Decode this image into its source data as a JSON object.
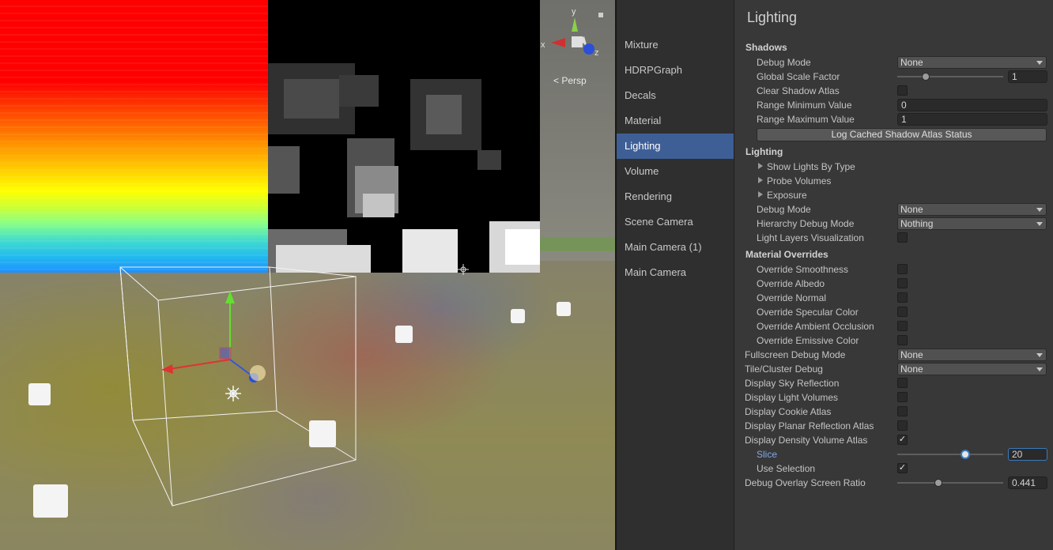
{
  "scene": {
    "view_mode": "Persp",
    "gizmo_axes": {
      "x": "x",
      "y": "y",
      "z": "z"
    }
  },
  "sidebar": {
    "items": [
      {
        "label": "Mixture",
        "active": false
      },
      {
        "label": "HDRPGraph",
        "active": false
      },
      {
        "label": "Decals",
        "active": false
      },
      {
        "label": "Material",
        "active": false
      },
      {
        "label": "Lighting",
        "active": true
      },
      {
        "label": "Volume",
        "active": false
      },
      {
        "label": "Rendering",
        "active": false
      },
      {
        "label": "Scene Camera",
        "active": false
      },
      {
        "label": "Main Camera (1)",
        "active": false
      },
      {
        "label": "Main Camera",
        "active": false
      }
    ]
  },
  "inspector": {
    "title": "Lighting",
    "shadows": {
      "header": "Shadows",
      "debug_mode": {
        "label": "Debug Mode",
        "value": "None"
      },
      "global_scale_factor": {
        "label": "Global Scale Factor",
        "value": "1",
        "level": 0.27
      },
      "clear_shadow_atlas": {
        "label": "Clear Shadow Atlas",
        "checked": false
      },
      "range_min": {
        "label": "Range Minimum Value",
        "value": "0"
      },
      "range_max": {
        "label": "Range Maximum Value",
        "value": "1"
      },
      "log_button": "Log Cached Shadow Atlas Status"
    },
    "lighting": {
      "header": "Lighting",
      "show_lights_by_type": "Show Lights By Type",
      "probe_volumes": "Probe Volumes",
      "exposure": "Exposure",
      "debug_mode": {
        "label": "Debug Mode",
        "value": "None"
      },
      "hierarchy_debug_mode": {
        "label": "Hierarchy Debug Mode",
        "value": "Nothing"
      },
      "light_layers_visualization": {
        "label": "Light Layers Visualization",
        "checked": false
      }
    },
    "material_overrides": {
      "header": "Material Overrides",
      "items": [
        {
          "label": "Override Smoothness",
          "checked": false
        },
        {
          "label": "Override Albedo",
          "checked": false
        },
        {
          "label": "Override Normal",
          "checked": false
        },
        {
          "label": "Override Specular Color",
          "checked": false
        },
        {
          "label": "Override Ambient Occlusion",
          "checked": false
        },
        {
          "label": "Override Emissive Color",
          "checked": false
        }
      ]
    },
    "fullscreen_debug_mode": {
      "label": "Fullscreen Debug Mode",
      "value": "None"
    },
    "tile_cluster_debug": {
      "label": "Tile/Cluster Debug",
      "value": "None"
    },
    "display_sky_reflection": {
      "label": "Display Sky Reflection",
      "checked": false
    },
    "display_light_volumes": {
      "label": "Display Light Volumes",
      "checked": false
    },
    "display_cookie_atlas": {
      "label": "Display Cookie Atlas",
      "checked": false
    },
    "display_planar_reflection_atlas": {
      "label": "Display Planar Reflection Atlas",
      "checked": false
    },
    "display_density_volume_atlas": {
      "label": "Display Density Volume Atlas",
      "checked": true
    },
    "slice": {
      "label": "Slice",
      "value": "20",
      "level": 0.64
    },
    "use_selection": {
      "label": "Use Selection",
      "checked": true
    },
    "debug_overlay_screen_ratio": {
      "label": "Debug Overlay Screen Ratio",
      "value": "0.441",
      "level": 0.39
    }
  },
  "glyphs": {
    "check": "✓"
  }
}
